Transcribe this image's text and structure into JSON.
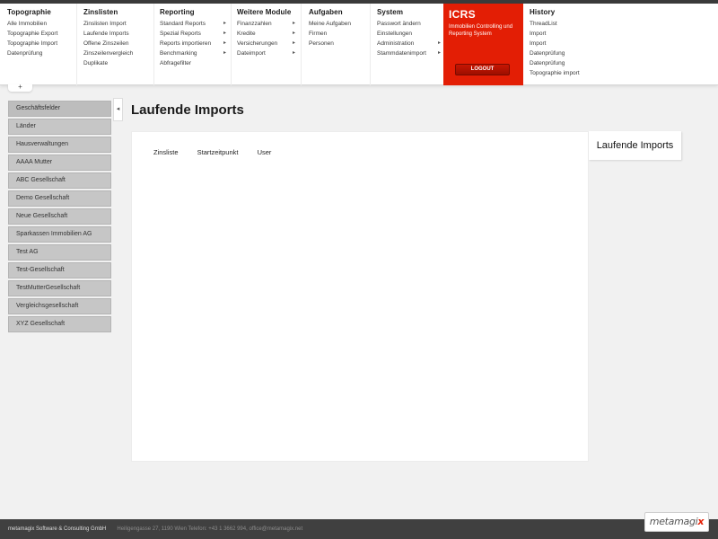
{
  "menu": {
    "topographie": {
      "heading": "Topographie",
      "items": [
        "Alle Immobilien",
        "Topographie Export",
        "Topographie Import",
        "Datenprüfung"
      ]
    },
    "zinslisten": {
      "heading": "Zinslisten",
      "items": [
        "Zinslisten Import",
        "Laufende Imports",
        "Offene Zinszeilen",
        "Zinszeilenvergleich",
        "Duplikate"
      ]
    },
    "reporting": {
      "heading": "Reporting",
      "items": [
        "Standard Reports",
        "Spezial Reports",
        "Reports importieren",
        "Benchmarking",
        "Abfragefilter"
      ]
    },
    "weitere": {
      "heading": "Weitere Module",
      "items": [
        "Finanzzahlen",
        "Kredite",
        "Versicherungen",
        "Dateimport"
      ]
    },
    "aufgaben": {
      "heading": "Aufgaben",
      "items": [
        "Meine Aufgaben",
        "Firmen",
        "Personen"
      ]
    },
    "system": {
      "heading": "System",
      "items": [
        "Passwort ändern",
        "Einstellungen",
        "Administration",
        "Stammdatenimport"
      ]
    },
    "history": {
      "heading": "History",
      "items": [
        "ThreadList",
        "Import",
        "Import",
        "Datenprüfung",
        "Datenprüfung",
        "Topographie import"
      ]
    },
    "arrow": "▸"
  },
  "brand": {
    "title": "ICRS",
    "subtitle": "Immobilien Controlling und Reporting System",
    "logout": "LOGOUT",
    "color": "#e31e05"
  },
  "handle": "+",
  "sidebar": {
    "toggle": "◂",
    "items": [
      "Geschäftsfelder",
      "Länder",
      "Hausverwaltungen",
      "AAAA Mutter",
      "ABC Gesellschaft",
      "Demo Gesellschaft",
      "Neue Gesellschaft",
      "Sparkassen Immobilien AG",
      "Test AG",
      "Test-Gesellschaft",
      "TestMutterGesellschaft",
      "Vergleichsgesellschaft",
      "XYZ Gesellschaft"
    ]
  },
  "page": {
    "title": "Laufende Imports"
  },
  "table": {
    "columns": [
      "Zinsliste",
      "Startzeitpunkt",
      "User"
    ]
  },
  "right_tab": "Laufende Imports",
  "footer": {
    "company": "metamagix Software & Consulting GmbH",
    "address": "Heiligengasse 27, 1190 Wien  Telefon: +43 1 3662 994, office@metamagix.net"
  },
  "logo": {
    "main": "metamagi",
    "accent": "x"
  }
}
